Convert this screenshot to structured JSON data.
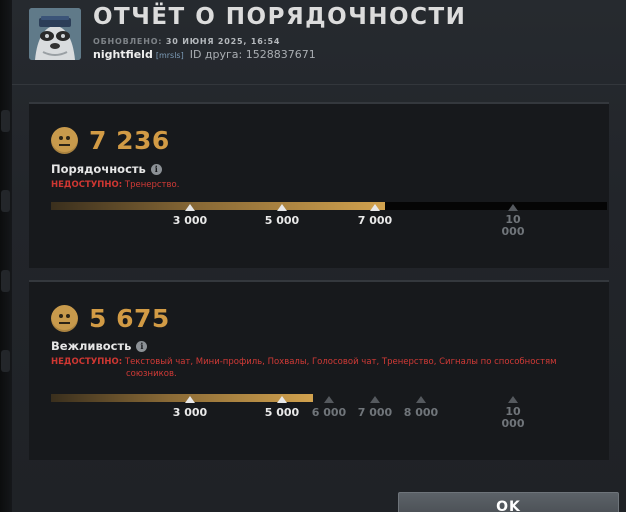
{
  "header": {
    "title": "ОТЧЁТ О ПОРЯДОЧНОСТИ",
    "updated_label": "ОБНОВЛЕНО:",
    "updated_date": "30 ИЮНЯ 2025, 16:54",
    "username": "nightfield",
    "user_tag": "[mrsls]",
    "friend_id": "ID друга: 1528837671"
  },
  "conduct": {
    "score": "7 236",
    "label": "Порядочность",
    "unavailable_lead": "НЕДОСТУПНО:",
    "unavailable_text": "Тренерство.",
    "progress_fraction": 0.6,
    "markers": [
      {
        "value": "3 000",
        "reached": true
      },
      {
        "value": "5 000",
        "reached": true
      },
      {
        "value": "7 000",
        "reached": true
      },
      {
        "value": "10 000",
        "reached": false
      }
    ]
  },
  "behavior": {
    "score": "5 675",
    "label": "Вежливость",
    "unavailable_lead": "НЕДОСТУПНО:",
    "unavailable_text_1": "Текстовый чат, Мини-профиль, Похвалы, Голосовой чат, Тренерство, Сигналы по способностям",
    "unavailable_text_2": "союзников.",
    "progress_fraction": 0.47,
    "markers": [
      {
        "value": "3 000",
        "reached": true
      },
      {
        "value": "5 000",
        "reached": true
      },
      {
        "value": "6 000",
        "reached": false
      },
      {
        "value": "7 000",
        "reached": false
      },
      {
        "value": "8 000",
        "reached": false
      },
      {
        "value": "10 000",
        "reached": false
      }
    ]
  },
  "ok_label": "OK",
  "icons": {
    "info": "info-icon",
    "face": "neutral-face-icon"
  },
  "colors": {
    "score": "#d29b45",
    "unavailable": "#d13a36",
    "bar_fill": "#d2a24e"
  }
}
